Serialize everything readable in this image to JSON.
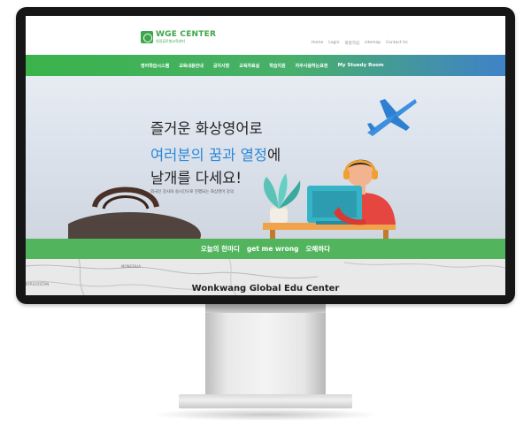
{
  "brand": {
    "title": "WGE CENTER",
    "subtitle": "원광글로벌교육센터",
    "accent": "#3da64a"
  },
  "utility_links": [
    "Home",
    "Login",
    "회원가입",
    "sitemap",
    "Contact Us"
  ],
  "nav": {
    "items": [
      "영어학습시스템",
      "교육내용안내",
      "공지사항",
      "교육자료실",
      "학습지원",
      "자주사용하는표현",
      "My Stuedy Room"
    ],
    "gradient_start": "#3bb34a",
    "gradient_end": "#3f82c8"
  },
  "hero": {
    "line1": "즐거운 화상영어로",
    "line2_blue": "여러분의 꿈과 열정",
    "line2_rest": "에",
    "line3": "날개를 다세요!",
    "sub": "외국인 강사와 실시간으로 진행되는 화상영어 강의",
    "accent_blue": "#2b87d8"
  },
  "phrase_bar": {
    "label": "오늘의 한마디",
    "english": "get me wrong",
    "korean": "오해하다",
    "color": "#52b55e"
  },
  "map": {
    "labels": [
      "MONGOLIA",
      "KYRGYZSTAN"
    ],
    "center_name": "Wonkwang Global Edu Center"
  }
}
